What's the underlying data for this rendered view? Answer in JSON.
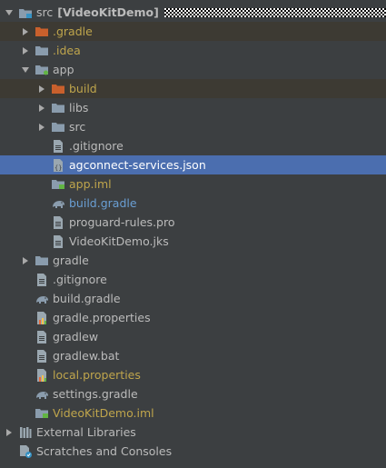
{
  "tree": {
    "root": {
      "label": "src",
      "module": "[VideoKitDemo]"
    },
    "items": [
      {
        "label": ".gradle"
      },
      {
        "label": ".idea"
      },
      {
        "label": "app"
      },
      {
        "label": "build"
      },
      {
        "label": "libs"
      },
      {
        "label": "src"
      },
      {
        "label": ".gitignore"
      },
      {
        "label": "agconnect-services.json"
      },
      {
        "label": "app.iml"
      },
      {
        "label": "build.gradle"
      },
      {
        "label": "proguard-rules.pro"
      },
      {
        "label": "VideoKitDemo.jks"
      },
      {
        "label": "gradle"
      },
      {
        "label": ".gitignore"
      },
      {
        "label": "build.gradle"
      },
      {
        "label": "gradle.properties"
      },
      {
        "label": "gradlew"
      },
      {
        "label": "gradlew.bat"
      },
      {
        "label": "local.properties"
      },
      {
        "label": "settings.gradle"
      },
      {
        "label": "VideoKitDemo.iml"
      },
      {
        "label": "External Libraries"
      },
      {
        "label": "Scratches and Consoles"
      }
    ]
  },
  "colors": {
    "background": "#3c3f41",
    "selection": "#4b6eaf",
    "ignored_row": "#3d3a33",
    "ignored_text": "#bfa54c",
    "modified_text": "#6a9fd4"
  }
}
